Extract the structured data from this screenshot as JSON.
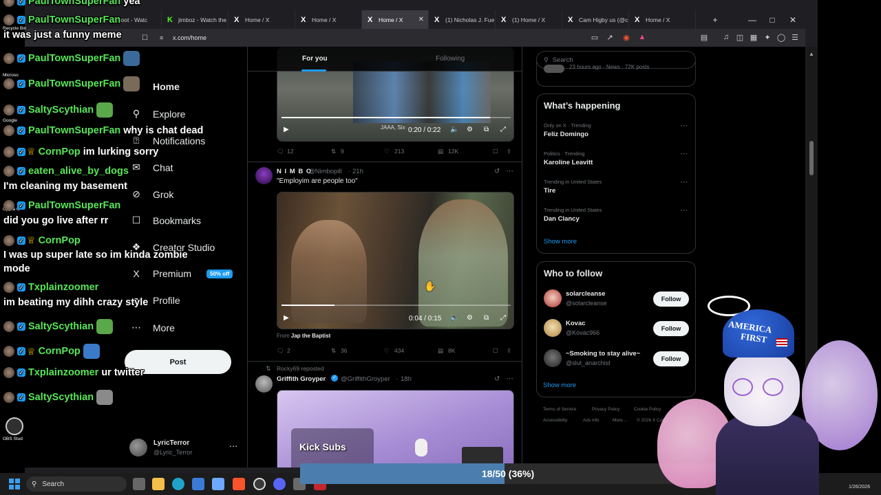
{
  "browser": {
    "tabs": [
      {
        "label": "zelroot - Watc",
        "icon": "twitch-icon",
        "active": false
      },
      {
        "label": "jimboz - Watch the",
        "icon": "kick-icon",
        "active": false
      },
      {
        "label": "Home / X",
        "icon": "x-icon",
        "active": false
      },
      {
        "label": "Home / X",
        "icon": "x-icon",
        "active": false
      },
      {
        "label": "Home / X",
        "icon": "x-icon",
        "active": true
      },
      {
        "label": "(1) Nicholas J. Fue",
        "icon": "x-icon",
        "active": false
      },
      {
        "label": "(1) Home / X",
        "icon": "x-icon",
        "active": false
      },
      {
        "label": "Cam Higby us (@c",
        "icon": "x-icon",
        "active": false
      },
      {
        "label": "Home / X",
        "icon": "x-icon",
        "active": false
      }
    ],
    "url": "x.com/home"
  },
  "nav": {
    "items": [
      {
        "label": "Home",
        "icon": "home-icon"
      },
      {
        "label": "Explore",
        "icon": "search-icon"
      },
      {
        "label": "Notifications",
        "icon": "bell-icon"
      },
      {
        "label": "Chat",
        "icon": "chat-icon"
      },
      {
        "label": "Grok",
        "icon": "grok-icon"
      },
      {
        "label": "Bookmarks",
        "icon": "bookmark-icon"
      },
      {
        "label": "Creator Studio",
        "icon": "creator-icon"
      },
      {
        "label": "Premium",
        "icon": "x-icon"
      },
      {
        "label": "Profile",
        "icon": "person-icon"
      },
      {
        "label": "More",
        "icon": "more-circle-icon"
      }
    ],
    "premium_badge": "50% off",
    "post_label": "Post",
    "account": {
      "name": "LyricTerror",
      "handle": "@Lyric_Terror"
    }
  },
  "feed": {
    "tabs": {
      "for_you": "For you",
      "following": "Following"
    },
    "tweet1": {
      "video_overlay_text": "JAAA, Six",
      "time": "0:20 / 0:22",
      "progress": 0.91,
      "replies": "12",
      "reposts": "9",
      "likes": "213",
      "views": "12K"
    },
    "tweet2": {
      "name": "N I M B O",
      "handle": "@Nimbopill",
      "time": "21h",
      "text": "\"Employim are people too\"",
      "video_time": "0:04 / 0:15",
      "progress": 0.23,
      "from_label": "From",
      "from_source": "Jap the Baptist",
      "replies": "2",
      "reposts": "36",
      "likes": "434",
      "views": "8K"
    },
    "tweet3": {
      "reposted_by": "Rocky69 reposted",
      "name": "Griffith Groyper",
      "handle": "@GriffithGroyper",
      "time": "18h",
      "media_text": "Kick Subs"
    }
  },
  "right": {
    "search_placeholder": "Search",
    "top_snippet": "23 hours ago · News · 72K posts",
    "whats_happening": {
      "title": "What’s happening",
      "trends": [
        {
          "context": "Only on X · Trending",
          "name": "Feliz Domingo"
        },
        {
          "context": "Politics · Trending",
          "name": "Karoline Leavitt"
        },
        {
          "context": "Trending in United States",
          "name": "Tire"
        },
        {
          "context": "Trending in United States",
          "name": "Dan Clancy"
        }
      ],
      "show_more": "Show more"
    },
    "who_to_follow": {
      "title": "Who to follow",
      "accounts": [
        {
          "name": "solarcleanse",
          "handle": "@solarcleanse"
        },
        {
          "name": "Kovac",
          "handle": "@Kovac966"
        },
        {
          "name": "~Smoking to stay alive~",
          "handle": "@slut_anarchist"
        }
      ],
      "follow_label": "Follow",
      "show_more": "Show more"
    },
    "footer": {
      "links": [
        "Terms of Service",
        "Privacy Policy",
        "Cookie Policy",
        "Accessibility",
        "Ads info",
        "More ...",
        "© 2026 X Corp."
      ]
    }
  },
  "chat": [
    {
      "user": "PaulTownSuperFan",
      "msg": "yea",
      "user_color": "#57e657"
    },
    {
      "user": "PaulTownSuperFan",
      "msg": "",
      "user_color": "#57e657"
    },
    {
      "user": "",
      "msg": "it was just a funny meme",
      "user_color": "#57e657"
    },
    {
      "user": "PaulTownSuperFan",
      "msg": "",
      "user_color": "#57e657"
    },
    {
      "user": "PaulTownSuperFan",
      "msg": "",
      "user_color": "#57e657"
    },
    {
      "user": "SaltyScythian",
      "msg": "",
      "user_color": "#57e657"
    },
    {
      "user": "PaulTownSuperFan",
      "msg": "why is chat dead",
      "user_color": "#57e657"
    },
    {
      "user": "CornPop",
      "msg": "im lurking sorry",
      "user_color": "#57e657"
    },
    {
      "user": "eaten_alive_by_dogs",
      "msg": "",
      "user_color": "#57e657"
    },
    {
      "user": "",
      "msg": "I'm cleaning my basement",
      "user_color": "#57e657"
    },
    {
      "user": "PaulTownSuperFan",
      "msg": "",
      "user_color": "#57e657"
    },
    {
      "user": "",
      "msg": "did you go live after rr",
      "user_color": "#57e657"
    },
    {
      "user": "CornPop",
      "msg": "",
      "user_color": "#57e657"
    },
    {
      "user": "",
      "msg": "I was up super late so im kinda zombie",
      "user_color": "#57e657"
    },
    {
      "user": "",
      "msg": "mode",
      "user_color": "#57e657"
    },
    {
      "user": "Txplainzoomer",
      "msg": "",
      "user_color": "#57e657"
    },
    {
      "user": "",
      "msg": "im beating my dihh crazy style",
      "user_color": "#57e657"
    },
    {
      "user": "SaltyScythian",
      "msg": "",
      "user_color": "#57e657"
    },
    {
      "user": "CornPop",
      "msg": "",
      "user_color": "#57e657"
    },
    {
      "user": "Txplainzoomer",
      "msg": "ur twitter",
      "user_color": "#57e657"
    },
    {
      "user": "SaltyScythian",
      "msg": "",
      "user_color": "#57e657"
    }
  ],
  "desktop_icons": [
    "Recycle Bin",
    "Microso",
    "Google",
    "Opera G",
    "OBS Stud"
  ],
  "progress": {
    "text": "18/50 (36%)",
    "fraction": 0.36
  },
  "taskbar": {
    "search_placeholder": "Search",
    "date": "1/26/2026"
  },
  "vtuber": {
    "hat_text_1": "AMERICA",
    "hat_text_2": "FIRST"
  },
  "colors": {
    "accent": "#1d9bf0",
    "chat_user": "#57e657",
    "progress_fill": "#4b7eaf"
  }
}
